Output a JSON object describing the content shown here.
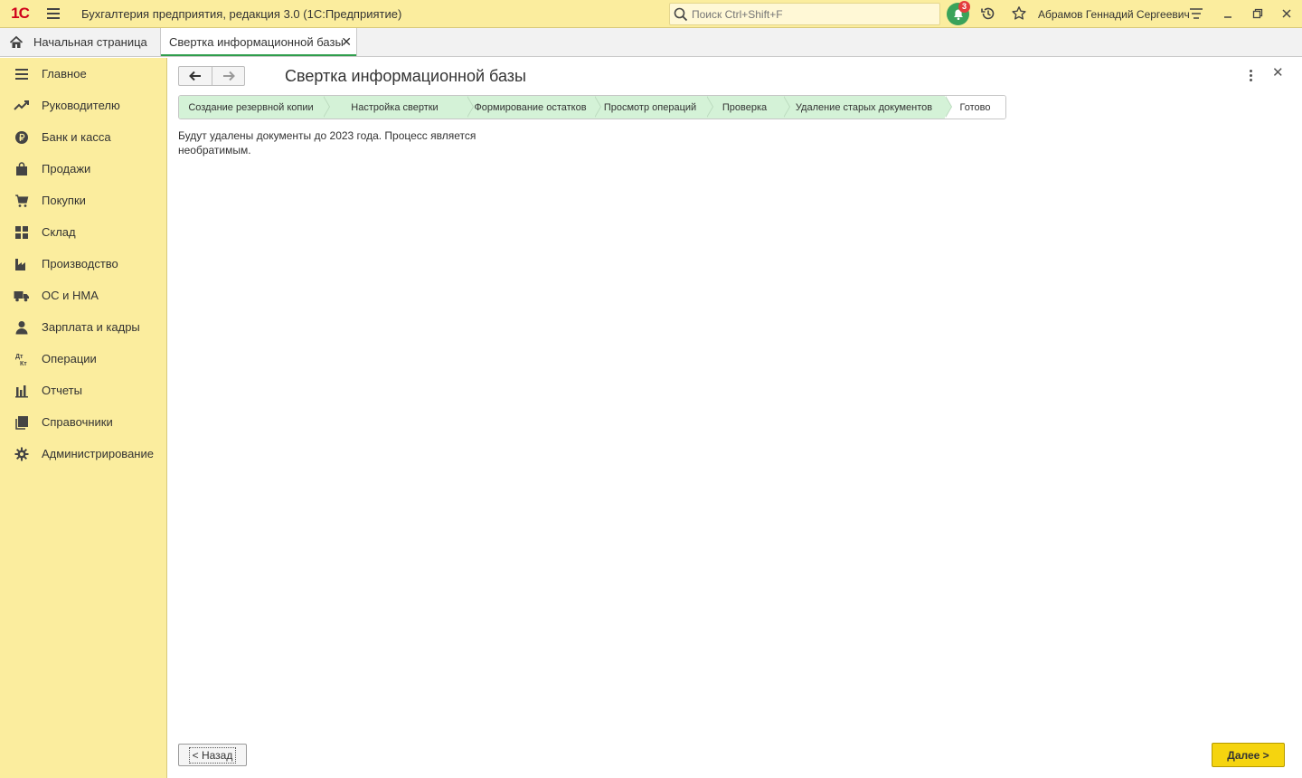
{
  "titlebar": {
    "logo_text": "1С",
    "app_title": "Бухгалтерия предприятия, редакция 3.0  (1С:Предприятие)",
    "search_placeholder": "Поиск Ctrl+Shift+F",
    "notifications_count": "3",
    "user_name": "Абрамов Геннадий Сергеевич",
    "accent_color": "#fbed9e"
  },
  "tabs": {
    "home_label": "Начальная страница",
    "active_label": "Свертка информационной базы",
    "close_symbol": "✕"
  },
  "sidebar": {
    "items": [
      {
        "label": "Главное",
        "icon": "list-icon"
      },
      {
        "label": "Руководителю",
        "icon": "trend-icon"
      },
      {
        "label": "Банк и касса",
        "icon": "ruble-coin-icon"
      },
      {
        "label": "Продажи",
        "icon": "shopping-bag-icon"
      },
      {
        "label": "Покупки",
        "icon": "cart-icon"
      },
      {
        "label": "Склад",
        "icon": "warehouse-grid-icon"
      },
      {
        "label": "Производство",
        "icon": "factory-icon"
      },
      {
        "label": "ОС и НМА",
        "icon": "truck-icon"
      },
      {
        "label": "Зарплата и кадры",
        "icon": "person-icon"
      },
      {
        "label": "Операции",
        "icon": "dt-kt-icon"
      },
      {
        "label": "Отчеты",
        "icon": "bar-chart-icon"
      },
      {
        "label": "Справочники",
        "icon": "books-icon"
      },
      {
        "label": "Администрирование",
        "icon": "gear-icon"
      }
    ]
  },
  "form": {
    "title": "Свертка информационной базы",
    "info_text": "Будут удалены документы до 2023 года. Процесс является необратимым.",
    "back_button": "< Назад",
    "next_button": "Далее >"
  },
  "steps": [
    {
      "label": "Создание резервной копии",
      "done": true
    },
    {
      "label": "Настройка свертки",
      "done": true
    },
    {
      "label": "Формирование остатков",
      "done": true
    },
    {
      "label": "Просмотр операций",
      "done": true
    },
    {
      "label": "Проверка",
      "done": true
    },
    {
      "label": "Удаление старых документов",
      "done": true
    },
    {
      "label": "Готово",
      "done": false
    }
  ]
}
